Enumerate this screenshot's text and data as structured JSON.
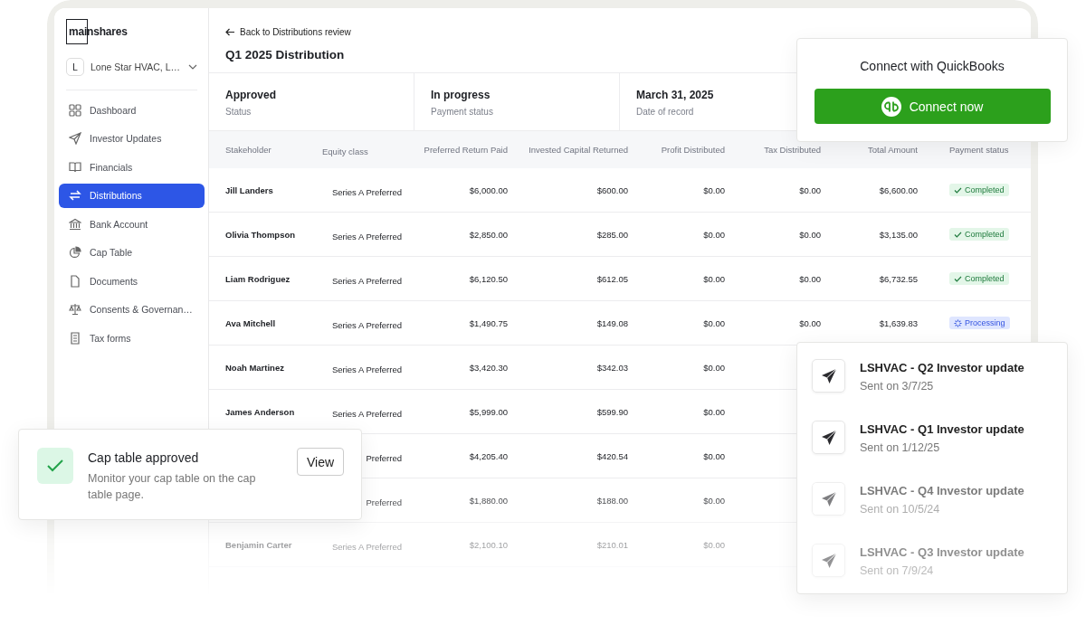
{
  "sidebar": {
    "logo": "mainshares",
    "org": {
      "initial": "L",
      "name": "Lone Star HVAC, L…"
    },
    "items": [
      {
        "label": "Dashboard",
        "selected": false
      },
      {
        "label": "Investor Updates",
        "selected": false
      },
      {
        "label": "Financials",
        "selected": false
      },
      {
        "label": "Distributions",
        "selected": true
      },
      {
        "label": "Bank Account",
        "selected": false
      },
      {
        "label": "Cap Table",
        "selected": false
      },
      {
        "label": "Documents",
        "selected": false
      },
      {
        "label": "Consents & Governan…",
        "selected": false
      },
      {
        "label": "Tax forms",
        "selected": false
      }
    ]
  },
  "header": {
    "back_link": "Back to Distributions review",
    "title": "Q1 2025 Distribution"
  },
  "summary": [
    {
      "value": "Approved",
      "label": "Status"
    },
    {
      "value": "In progress",
      "label": "Payment status"
    },
    {
      "value": "March 31, 2025",
      "label": "Date of record"
    }
  ],
  "table": {
    "columns": [
      "Stakeholder",
      "Equity class",
      "Preferred Return Paid",
      "Invested Capital Returned",
      "Profit Distributed",
      "Tax Distributed",
      "Total Amount",
      "Payment status"
    ],
    "rows": [
      {
        "stakeholder": "Jill Landers",
        "equity_class": "Series A Preferred",
        "preferred_return": "$6,000.00",
        "capital_returned": "$600.00",
        "profit": "$0.00",
        "tax": "$0.00",
        "total": "$6,600.00",
        "status": {
          "label": "Completed",
          "kind": "completed"
        }
      },
      {
        "stakeholder": "Olivia Thompson",
        "equity_class": "Series A Preferred",
        "preferred_return": "$2,850.00",
        "capital_returned": "$285.00",
        "profit": "$0.00",
        "tax": "$0.00",
        "total": "$3,135.00",
        "status": {
          "label": "Completed",
          "kind": "completed"
        }
      },
      {
        "stakeholder": "Liam Rodriguez",
        "equity_class": "Series A Preferred",
        "preferred_return": "$6,120.50",
        "capital_returned": "$612.05",
        "profit": "$0.00",
        "tax": "$0.00",
        "total": "$6,732.55",
        "status": {
          "label": "Completed",
          "kind": "completed"
        }
      },
      {
        "stakeholder": "Ava Mitchell",
        "equity_class": "Series A Preferred",
        "preferred_return": "$1,490.75",
        "capital_returned": "$149.08",
        "profit": "$0.00",
        "tax": "$0.00",
        "total": "$1,639.83",
        "status": {
          "label": "Processing",
          "kind": "processing"
        }
      },
      {
        "stakeholder": "Noah Martinez",
        "equity_class": "Series A Preferred",
        "preferred_return": "$3,420.30",
        "capital_returned": "$342.03",
        "profit": "$0.00"
      },
      {
        "stakeholder": "James Anderson",
        "equity_class": "Series A Preferred",
        "preferred_return": "$5,999.00",
        "capital_returned": "$599.90",
        "profit": "$0.00"
      },
      {
        "equity_class": "Preferred",
        "preferred_return": "$4,205.40",
        "capital_returned": "$420.54",
        "profit": "$0.00"
      },
      {
        "equity_class": "Preferred",
        "preferred_return": "$1,880.00",
        "capital_returned": "$188.00",
        "profit": "$0.00"
      },
      {
        "stakeholder": "Benjamin Carter",
        "equity_class": "Series A Preferred",
        "preferred_return": "$2,100.10",
        "capital_returned": "$210.01",
        "profit": "$0.00"
      }
    ]
  },
  "quickbooks": {
    "title": "Connect with QuickBooks",
    "button": "Connect now"
  },
  "toast": {
    "title": "Cap table approved",
    "message": "Monitor your cap table on the cap table page.",
    "button": "View"
  },
  "updates": [
    {
      "title": "LSHVAC - Q2 Investor update",
      "sent": "Sent on 3/7/25"
    },
    {
      "title": "LSHVAC - Q1 Investor update",
      "sent": "Sent on 1/12/25"
    },
    {
      "title": "LSHVAC - Q4 Investor update",
      "sent": "Sent on 10/5/24"
    },
    {
      "title": "LSHVAC - Q3 Investor update",
      "sent": "Sent on 7/9/24"
    }
  ]
}
